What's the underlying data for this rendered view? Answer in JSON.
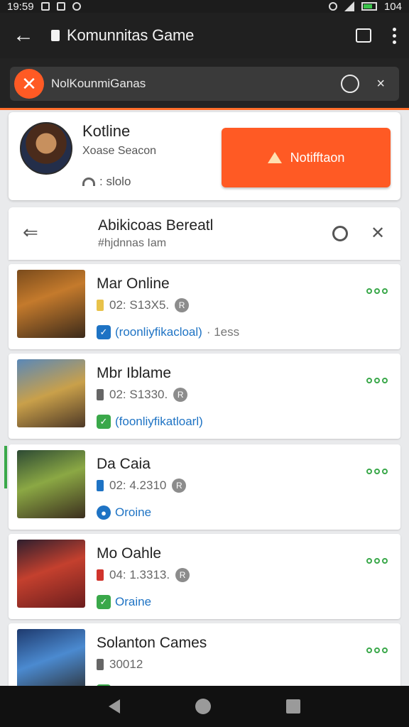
{
  "status_bar": {
    "time": "19:59",
    "right_text": "104"
  },
  "app_bar": {
    "title": "Komunnitas Game"
  },
  "url_bar": {
    "text": "NolKounmiGanas",
    "logo_letter": "✕"
  },
  "profile": {
    "name": "Kotline",
    "subtitle": "Xoase Seacon",
    "stat": ": slolo",
    "notify_label": "Notifftaon"
  },
  "section": {
    "title": "Abikicoas Bereatl",
    "subtitle": "#hjdnnas Iam"
  },
  "games": [
    {
      "name": "Mar Online",
      "meta": "02: S13X5.",
      "chip_color": "#e8c24a",
      "status_icon": "check",
      "status_color": "#1e73c4",
      "status_label": "(roonliyfikacloal)",
      "status_extra": "· 1ess"
    },
    {
      "name": "Mbr Iblame",
      "meta": "02: S1330.",
      "chip_color": "#666666",
      "status_icon": "check",
      "status_color": "#3aa84a",
      "status_label": "(foonliyfikatloarl)",
      "status_extra": ""
    },
    {
      "name": "Da Caia",
      "meta": "02: 4.2310",
      "chip_color": "#1e73c4",
      "status_icon": "dot",
      "status_color": "#1e73c4",
      "status_label": "Oroine",
      "status_extra": ""
    },
    {
      "name": "Mo Oahle",
      "meta": "04: 1.3313.",
      "chip_color": "#d0342c",
      "status_icon": "check",
      "status_color": "#3aa84a",
      "status_label": "Oraine",
      "status_extra": ""
    },
    {
      "name": "Solanton Cames",
      "meta": "30012",
      "chip_color": "#666666",
      "status_icon": "check",
      "status_color": "#3aa84a",
      "status_label": "",
      "status_extra": ""
    }
  ],
  "colors": {
    "accent": "#ff5a24",
    "online": "#3aa84a",
    "link": "#1e73c4"
  }
}
